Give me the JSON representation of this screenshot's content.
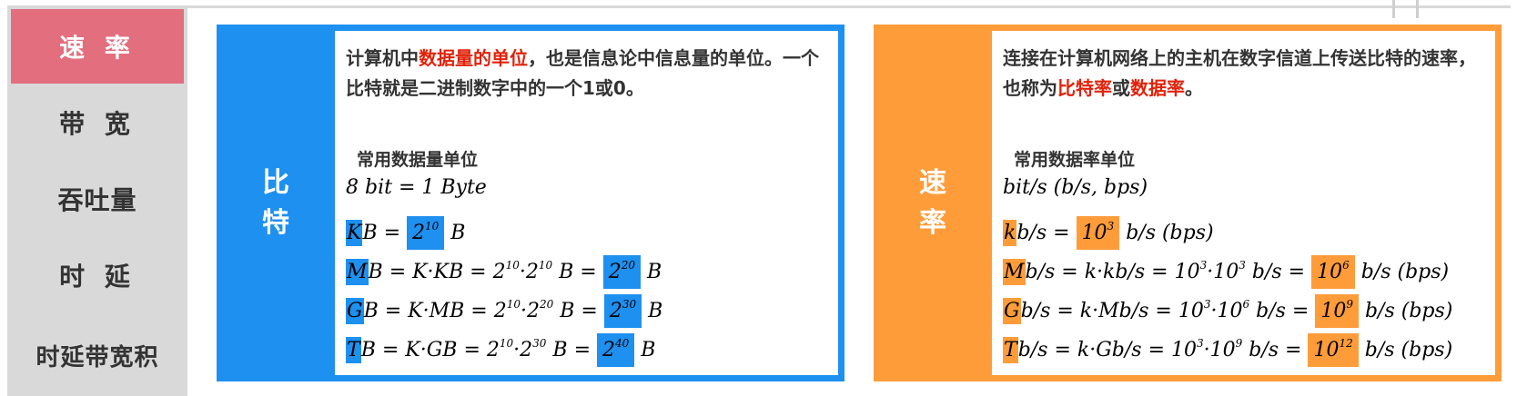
{
  "sidebar": {
    "items": [
      {
        "label": "速 率",
        "active": true
      },
      {
        "label": "带 宽",
        "active": false
      },
      {
        "label": "吞吐量",
        "active": false
      },
      {
        "label": "时 延",
        "active": false
      },
      {
        "label": "时延带宽积",
        "active": false
      }
    ]
  },
  "left_card": {
    "side_label": "比特",
    "intro_1": "计算机中",
    "intro_hl": "数据量的单位",
    "intro_2": "，也是信息论中信息量的单位。一个比特就是二进制数字中的一个1或0。",
    "subheading": "常用数据量单位",
    "f1": "8  bit  =  1  Byte",
    "kb_unit": "K",
    "kb_rest": "B  =  ",
    "kb_exp": "10",
    "kb_tail": "  B",
    "mb_unit": "M",
    "mb_rest": "B  =  K·KB  =  2",
    "mb_e1": "10",
    "mb_mid": "·2",
    "mb_e2": "10",
    "mb_b": "  B  =  ",
    "mb_res": "20",
    "gb_unit": "G",
    "gb_rest": "B  =  K·MB  =  2",
    "gb_e1": "10",
    "gb_mid": "·2",
    "gb_e2": "20",
    "gb_res": "30",
    "tb_unit": "T",
    "tb_rest": "B  =  K·GB  =  2",
    "tb_e1": "10",
    "tb_mid": "·2",
    "tb_e2": "30",
    "tb_res": "40",
    "base": "2",
    "unit_B": "  B"
  },
  "right_card": {
    "side_label": "速率",
    "intro_1": "连接在计算机网络上的主机在数字信道上传送比特的速率，也称为",
    "intro_hl1": "比特率",
    "intro_or": "或",
    "intro_hl2": "数据率",
    "intro_end": "。",
    "subheading": "常用数据率单位",
    "f1": "bit/s  (b/s,  bps)",
    "kb_unit": "k",
    "kb_rest": "b/s  =  ",
    "kb_exp": "3",
    "kb_tail": "  b/s  (bps)",
    "mb_unit": "M",
    "mb_rest": "b/s  =  k·kb/s  =  10",
    "mb_e1": "3",
    "mb_mid": "·10",
    "mb_e2": "3",
    "mb_res": "6",
    "gb_unit": "G",
    "gb_rest": "b/s  =  k·Mb/s  =  10",
    "gb_e1": "3",
    "gb_mid": "·10",
    "gb_e2": "6",
    "gb_res": "9",
    "tb_unit": "T",
    "tb_rest": "b/s  =  k·Gb/s  =  10",
    "tb_e1": "3",
    "tb_mid": "·10",
    "tb_e2": "9",
    "tb_res": "12",
    "base": "10",
    "eq_b": "  b/s  =  ",
    "unit_tail": "  b/s  (bps)"
  },
  "colors": {
    "accent_blue": "#1e90f0",
    "accent_orange": "#ff9c3a",
    "active_nav": "#e36e7e",
    "highlight_text": "#e0220a"
  }
}
